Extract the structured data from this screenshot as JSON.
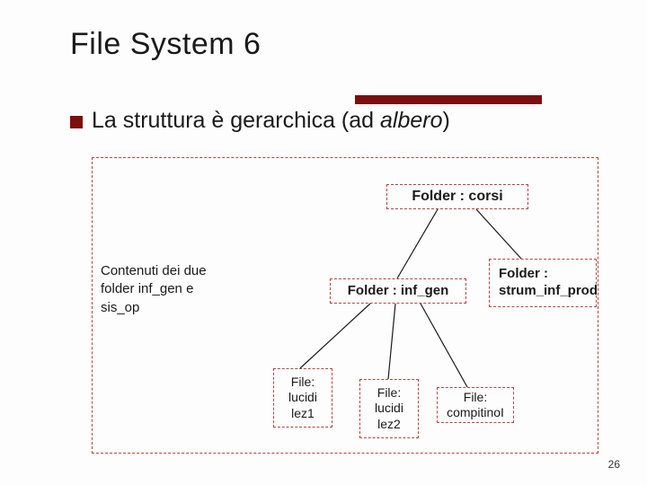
{
  "title": "File System  6",
  "bullet": {
    "text_a": "La struttura è gerarchica (ad ",
    "text_b_italic": "albero",
    "text_c": ")"
  },
  "side_caption": "Contenuti dei due folder inf_gen e sis_op",
  "nodes": {
    "corsi": "Folder : corsi",
    "inf_gen": "Folder : inf_gen",
    "strum": "Folder : strum_inf_prod",
    "file1": "File: lucidi lez1",
    "file2": "File: lucidi lez2",
    "file3": "File: compitinoI"
  },
  "page_number": "26"
}
